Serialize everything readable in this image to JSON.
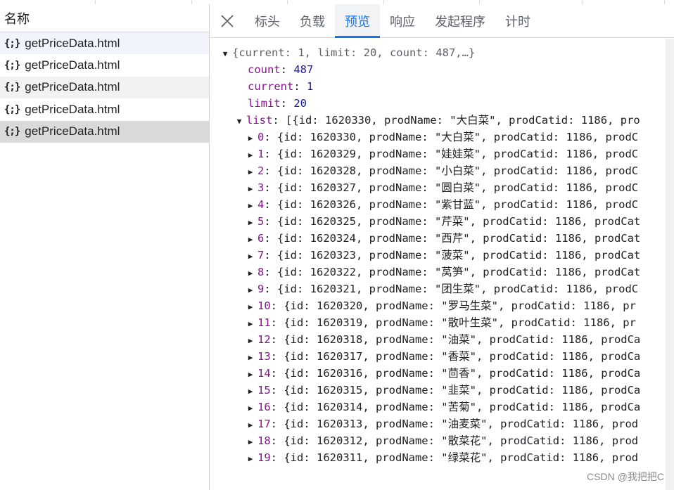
{
  "left_header": "名称",
  "requests": [
    "getPriceData.html",
    "getPriceData.html",
    "getPriceData.html",
    "getPriceData.html",
    "getPriceData.html"
  ],
  "requests_brace_icon": "{;}",
  "tabs": [
    "标头",
    "负载",
    "预览",
    "响应",
    "发起程序",
    "计时"
  ],
  "active_tab": "预览",
  "preview": {
    "root_summary": "{current: 1, limit: 20, count: 487,…}",
    "count_key": "count",
    "count_value": "487",
    "current_key": "current",
    "current_value": "1",
    "limit_key": "limit",
    "limit_value": "20",
    "list_key": "list",
    "list_summary": "[{id: 1620330, prodName: \"大白菜\", prodCatid: 1186, pro",
    "items": [
      {
        "index": "0",
        "rest": "{id: 1620330, prodName: \"大白菜\", prodCatid: 1186, prodC"
      },
      {
        "index": "1",
        "rest": "{id: 1620329, prodName: \"娃娃菜\", prodCatid: 1186, prodC"
      },
      {
        "index": "2",
        "rest": "{id: 1620328, prodName: \"小白菜\", prodCatid: 1186, prodC"
      },
      {
        "index": "3",
        "rest": "{id: 1620327, prodName: \"圆白菜\", prodCatid: 1186, prodC"
      },
      {
        "index": "4",
        "rest": "{id: 1620326, prodName: \"紫甘蓝\", prodCatid: 1186, prodC"
      },
      {
        "index": "5",
        "rest": "{id: 1620325, prodName: \"芹菜\", prodCatid: 1186, prodCat"
      },
      {
        "index": "6",
        "rest": "{id: 1620324, prodName: \"西芹\", prodCatid: 1186, prodCat"
      },
      {
        "index": "7",
        "rest": "{id: 1620323, prodName: \"菠菜\", prodCatid: 1186, prodCat"
      },
      {
        "index": "8",
        "rest": "{id: 1620322, prodName: \"莴笋\", prodCatid: 1186, prodCat"
      },
      {
        "index": "9",
        "rest": "{id: 1620321, prodName: \"团生菜\", prodCatid: 1186, prodC"
      },
      {
        "index": "10",
        "rest": "{id: 1620320, prodName: \"罗马生菜\", prodCatid: 1186, pr"
      },
      {
        "index": "11",
        "rest": "{id: 1620319, prodName: \"散叶生菜\", prodCatid: 1186, pr"
      },
      {
        "index": "12",
        "rest": "{id: 1620318, prodName: \"油菜\", prodCatid: 1186, prodCa"
      },
      {
        "index": "13",
        "rest": "{id: 1620317, prodName: \"香菜\", prodCatid: 1186, prodCa"
      },
      {
        "index": "14",
        "rest": "{id: 1620316, prodName: \"茴香\", prodCatid: 1186, prodCa"
      },
      {
        "index": "15",
        "rest": "{id: 1620315, prodName: \"韭菜\", prodCatid: 1186, prodCa"
      },
      {
        "index": "16",
        "rest": "{id: 1620314, prodName: \"苦菊\", prodCatid: 1186, prodCa"
      },
      {
        "index": "17",
        "rest": "{id: 1620313, prodName: \"油麦菜\", prodCatid: 1186, prod"
      },
      {
        "index": "18",
        "rest": "{id: 1620312, prodName: \"散菜花\", prodCatid: 1186, prod"
      },
      {
        "index": "19",
        "rest": "{id: 1620311, prodName: \"绿菜花\", prodCatid: 1186, prod"
      }
    ]
  },
  "watermark": "CSDN @我把把C",
  "colors": {
    "accent": "#1a73e8",
    "key": "#881391",
    "number": "#1a1aa6"
  }
}
